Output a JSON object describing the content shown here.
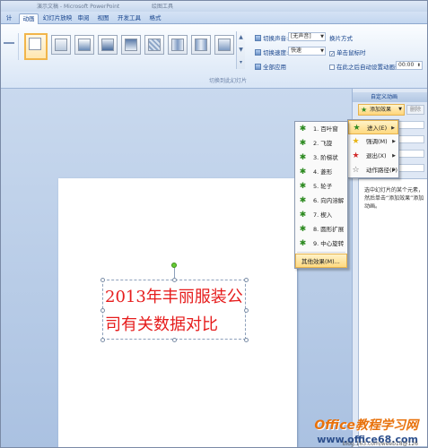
{
  "titlebar": {
    "doc_title": "演示文稿 - Microsoft PowerPoint",
    "tool_context": "绘图工具"
  },
  "tabs": [
    {
      "label": "计"
    },
    {
      "label": "动画"
    },
    {
      "label": "幻灯片放映"
    },
    {
      "label": "审阅"
    },
    {
      "label": "视图"
    },
    {
      "label": "开发工具"
    },
    {
      "label": "格式"
    }
  ],
  "ribbon": {
    "transition_group_label": "切换到此幻灯片",
    "sound_label": "切换声音:",
    "sound_value": "[无声音]",
    "speed_label": "切换速度:",
    "speed_value": "快速",
    "apply_all_label": "全部应用",
    "advance_header": "换片方式",
    "on_click_label": "单击鼠标时",
    "auto_label": "在此之后自动设置动画效果:",
    "auto_time": "00:00"
  },
  "slide": {
    "text": "2013年丰丽服装公司有关数据对比"
  },
  "taskpane": {
    "title": "自定义动画",
    "add_effect": "添加效果",
    "remove": "删除",
    "hint": "选中幻灯片的某个元素，然后单击“添加效果”添加动画。"
  },
  "effect_menu": {
    "items": [
      {
        "label": "进入(E)",
        "icon": "entrance-star-icon"
      },
      {
        "label": "强调(M)",
        "icon": "emphasis-star-icon"
      },
      {
        "label": "退出(X)",
        "icon": "exit-star-icon"
      },
      {
        "label": "动作路径(P)",
        "icon": "motion-path-icon"
      }
    ]
  },
  "entrance_menu": {
    "items": [
      {
        "label": "1. 百叶窗"
      },
      {
        "label": "2. 飞旋"
      },
      {
        "label": "3. 阶梯状"
      },
      {
        "label": "4. 菱形"
      },
      {
        "label": "5. 轮子"
      },
      {
        "label": "6. 向内溶解"
      },
      {
        "label": "7. 楔入"
      },
      {
        "label": "8. 圆形扩展"
      },
      {
        "label": "9. 中心旋转"
      }
    ],
    "more": "其他效果(M)..."
  },
  "watermark": {
    "brand": "Office教程学习网",
    "url": "www.office68.com",
    "blog": "blog.163.com/weeb18@126"
  },
  "colors": {
    "slide_text": "#e61c1c",
    "highlight": "#ffd980",
    "brand": "#e8720c"
  }
}
